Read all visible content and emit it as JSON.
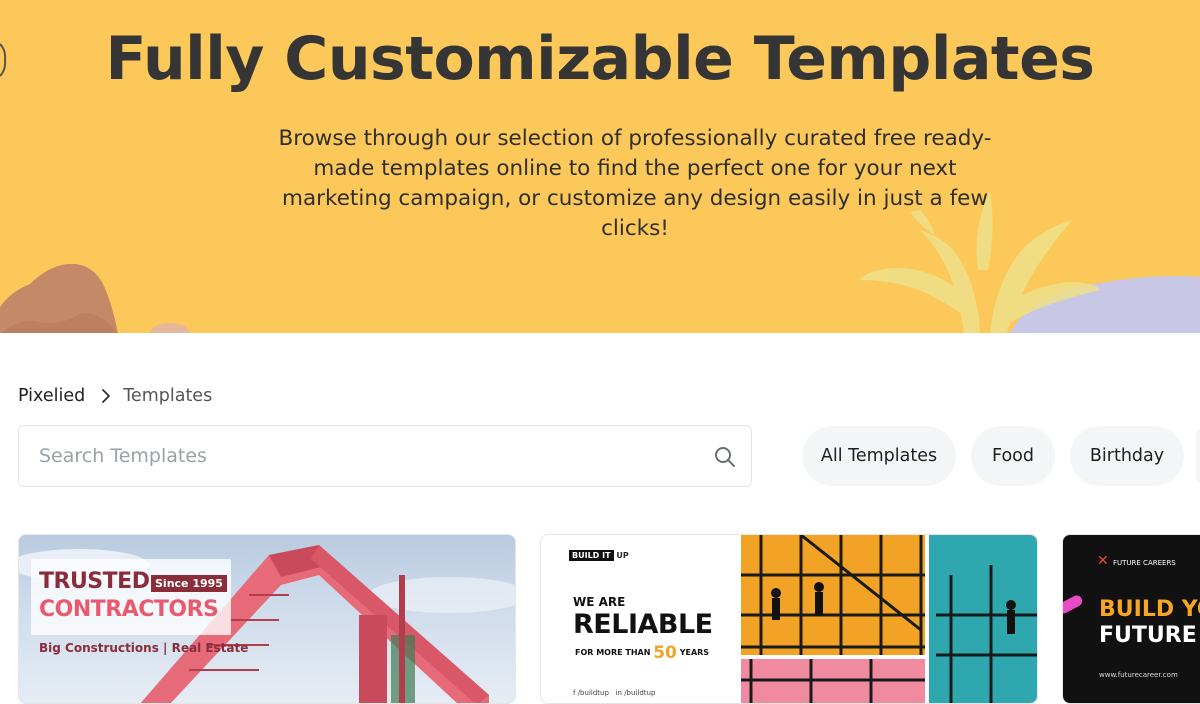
{
  "hero": {
    "title": "Fully Customizable Templates",
    "subtitle": "Browse through our selection of professionally curated free ready-made templates online to find the perfect one for your next marketing campaign, or customize any design easily in just a few clicks!",
    "background_color": "#fcc85a"
  },
  "breadcrumb": {
    "home": "Pixelied",
    "current": "Templates",
    "separator_icon": "chevron-right-icon"
  },
  "search": {
    "placeholder": "Search Templates",
    "value": "",
    "icon": "search-icon"
  },
  "categories": [
    {
      "label": "All Templates"
    },
    {
      "label": "Food"
    },
    {
      "label": "Birthday"
    }
  ],
  "templates": [
    {
      "headline_1": "TRUSTED",
      "badge": "Since 1995",
      "headline_2": "CONTRACTORS",
      "tagline": "Big Constructions | Real Estate"
    },
    {
      "logo_box": "BUILD IT",
      "logo_rest": "UP",
      "line_1": "WE ARE",
      "line_2": "RELIABLE",
      "line_3_prefix": "FOR MORE THAN",
      "line_3_number": "50",
      "line_3_suffix": "YEARS",
      "social_1": "/buildtup",
      "social_2": "/buildtup"
    },
    {
      "logo": "FUTURE CAREERS",
      "headline_1": "BUILD YO",
      "headline_2": "FUTURE W",
      "url": "www.futurecareer.com"
    }
  ]
}
